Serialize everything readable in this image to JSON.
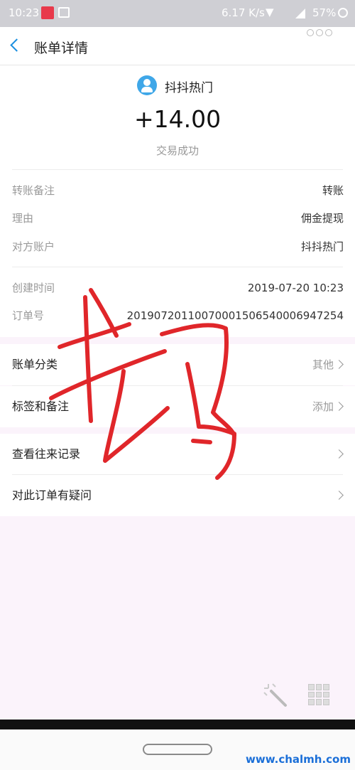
{
  "status_bar": {
    "time": "10:23",
    "speed": "6.17 K/s",
    "battery": "57%"
  },
  "header": {
    "title": "账单详情"
  },
  "summary": {
    "payee": "抖抖热门",
    "amount": "+14.00",
    "status": "交易成功"
  },
  "details": [
    {
      "label": "转账备注",
      "value": "转账"
    },
    {
      "label": "理由",
      "value": "佣金提现"
    },
    {
      "label": "对方账户",
      "value": "抖抖热门"
    }
  ],
  "order_info": [
    {
      "label": "创建时间",
      "value": "2019-07-20 10:23"
    },
    {
      "label": "订单号",
      "value": "20190720110070001506540006947254"
    }
  ],
  "actions_group1": [
    {
      "label": "账单分类",
      "value": "其他"
    },
    {
      "label": "标签和备注",
      "value": "添加"
    }
  ],
  "actions_group2": [
    {
      "label": "查看往来记录"
    },
    {
      "label": "对此订单有疑问"
    }
  ],
  "overlay": {
    "handwriting_color": "#e0262a"
  },
  "colors": {
    "accent": "#1a8fe0",
    "page_bg": "#fbf3fb"
  },
  "watermark": "www.chalmh.com"
}
